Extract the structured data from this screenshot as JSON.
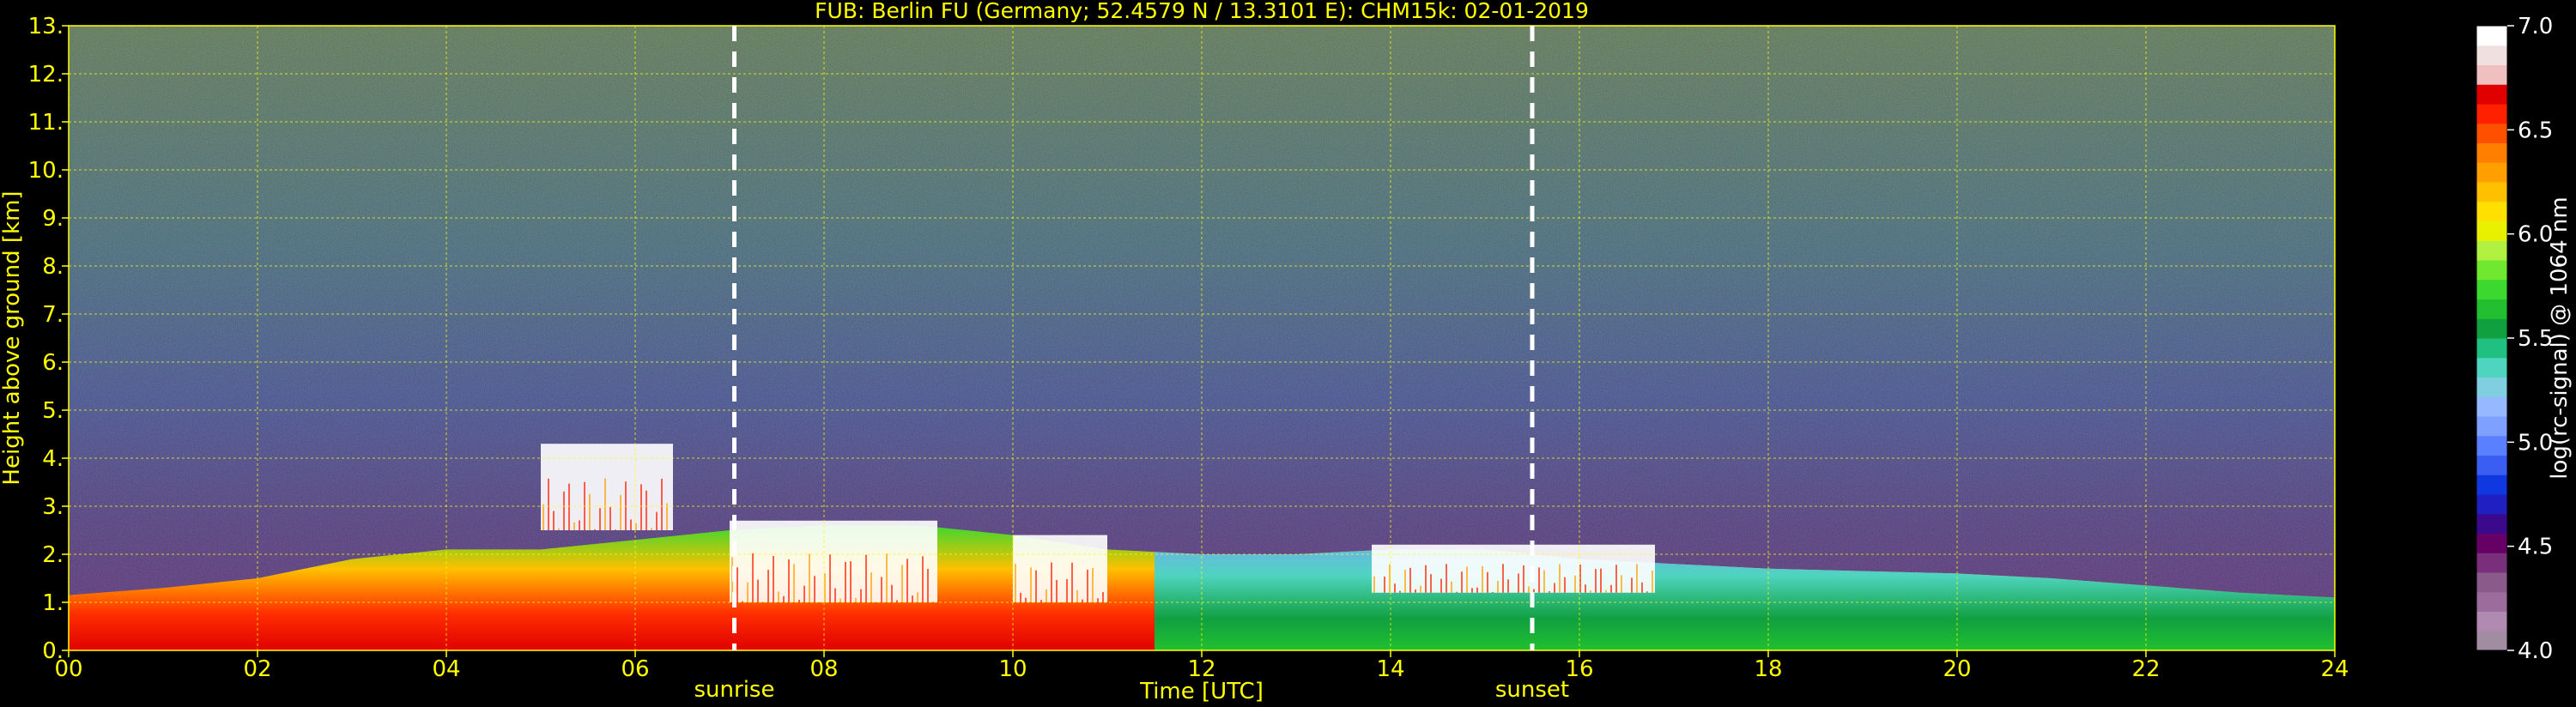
{
  "chart_data": {
    "type": "heatmap",
    "title": "FUB: Berlin FU (Germany; 52.4579 N / 13.3101 E):    CHM15k: 02-01-2019",
    "xlabel": "Time [UTC]",
    "ylabel": "Height above ground [km]",
    "xlim": [
      0,
      24
    ],
    "ylim": [
      0,
      13
    ],
    "x_ticks": [
      "00",
      "02",
      "04",
      "06",
      "08",
      "10",
      "12",
      "14",
      "16",
      "18",
      "20",
      "22",
      "24"
    ],
    "y_ticks": [
      "0.",
      "1.",
      "2.",
      "3.",
      "4.",
      "5.",
      "6.",
      "7.",
      "8.",
      "9.",
      "10.",
      "11.",
      "12.",
      "13."
    ],
    "grid": true,
    "annotations": [
      {
        "label": "sunrise",
        "time_utc": 7.05
      },
      {
        "label": "sunset",
        "time_utc": 15.5
      }
    ],
    "colorbar": {
      "label": "log(rc-signal) @ 1064 nm",
      "range": [
        4.0,
        7.0
      ],
      "ticks": [
        "4.0",
        "4.5",
        "5.0",
        "5.5",
        "6.0",
        "6.5",
        "7.0"
      ],
      "colors": [
        "#a28ca2",
        "#b08ab0",
        "#9c6c9c",
        "#8a5a8a",
        "#7a2f7a",
        "#660066",
        "#3b0a8c",
        "#2020c0",
        "#1038e0",
        "#3a5ef2",
        "#5a80ff",
        "#7ea0ff",
        "#96b8ff",
        "#7fcfe0",
        "#4fd4c0",
        "#20c080",
        "#10a040",
        "#22c030",
        "#3cd830",
        "#70e830",
        "#b0f040",
        "#e8f000",
        "#ffe000",
        "#ffc000",
        "#ffa000",
        "#ff8000",
        "#ff5000",
        "#ff2000",
        "#e00000",
        "#f0c0c0",
        "#f0e0e0",
        "#ffffff"
      ]
    },
    "cloud_features": [
      {
        "type": "boundary_layer_top_km",
        "profile": [
          [
            0,
            1.15
          ],
          [
            1,
            1.3
          ],
          [
            2,
            1.5
          ],
          [
            3,
            1.9
          ],
          [
            4,
            2.1
          ],
          [
            5,
            2.1
          ],
          [
            6,
            2.3
          ],
          [
            7,
            2.5
          ],
          [
            8,
            2.6
          ],
          [
            9,
            2.6
          ],
          [
            10,
            2.4
          ],
          [
            11,
            2.1
          ],
          [
            12,
            2.0
          ],
          [
            13,
            2.0
          ],
          [
            14,
            2.1
          ],
          [
            15,
            2.1
          ],
          [
            16,
            1.9
          ],
          [
            17,
            1.8
          ],
          [
            18,
            1.7
          ],
          [
            19,
            1.65
          ],
          [
            20,
            1.6
          ],
          [
            21,
            1.5
          ],
          [
            22,
            1.35
          ],
          [
            23,
            1.2
          ],
          [
            24,
            1.1
          ]
        ]
      },
      {
        "type": "cloud_layer",
        "start": 5.0,
        "end": 6.4,
        "base_km": 2.5,
        "top_km": 4.3
      },
      {
        "type": "cloud_layer",
        "start": 7.0,
        "end": 9.2,
        "base_km": 1.0,
        "top_km": 2.7
      },
      {
        "type": "cloud_layer",
        "start": 10.0,
        "end": 11.0,
        "base_km": 1.0,
        "top_km": 2.4
      },
      {
        "type": "cloud_layer",
        "start": 13.8,
        "end": 16.8,
        "base_km": 1.2,
        "top_km": 2.2
      }
    ]
  }
}
